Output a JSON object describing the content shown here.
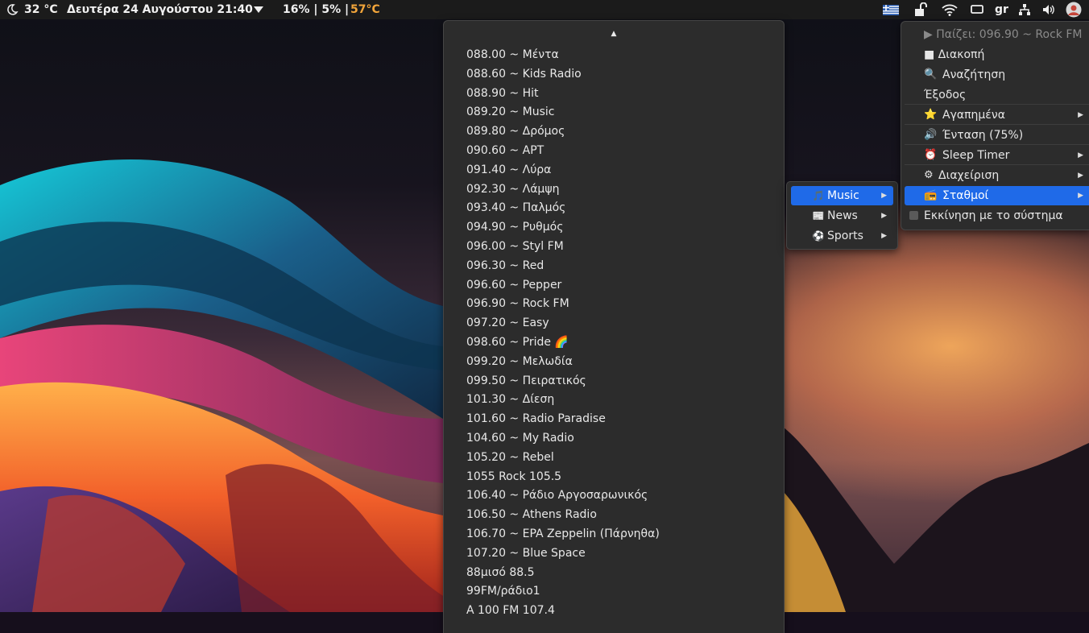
{
  "topbar": {
    "weather": "32 °C",
    "datetime": "Δευτέρα 24 Αυγούστου 21:40",
    "cpu": "16% | 5% |",
    "cpu_temp": "57°C",
    "keyboard_layout": "gr",
    "colors": {
      "bar_bg": "#1b1b1b",
      "hot": "#f2a53a"
    }
  },
  "stations_menu": {
    "scroll_indicator": "▲",
    "items": [
      "088.00 ~ Μέντα",
      "088.60 ~ Kids Radio",
      "088.90 ~ Hit",
      "089.20 ~ Music",
      "089.80 ~ Δρόμος",
      "090.60 ~ ΑΡΤ",
      "091.40 ~ Λύρα",
      "092.30 ~ Λάμψη",
      "093.40 ~ Παλμός",
      "094.90 ~ Ρυθμός",
      "096.00 ~ Styl FM",
      "096.30 ~ Red",
      "096.60 ~ Pepper",
      "096.90 ~ Rock FM",
      "097.20 ~ Easy",
      "098.60 ~ Pride 🌈",
      "099.20 ~ Μελωδία",
      "099.50 ~ Πειρατικός",
      "101.30 ~ Δίεση",
      "101.60 ~ Radio Paradise",
      "104.60 ~ My Radio",
      "105.20 ~ Rebel",
      "1055 Rock 105.5",
      "106.40 ~ Ράδιο Αργοσαρωνικός",
      "106.50 ~ Athens Radio",
      "106.70 ~ EPA Zeppelin (Πάρνηθα)",
      "107.20 ~ Blue Space",
      "88μισό 88.5",
      "99FM/ράδιο1",
      "A 100 FM 107.4"
    ]
  },
  "categories_menu": {
    "items": [
      {
        "icon": "🎵",
        "label": "Music",
        "active": true
      },
      {
        "icon": "📰",
        "label": "News",
        "active": false
      },
      {
        "icon": "⚽",
        "label": "Sports",
        "active": false
      }
    ],
    "submenu_arrow": "▶"
  },
  "main_menu": {
    "now_playing": "▶ Παίζει: 096.90 ~ Rock FM",
    "stop": "■ Διακοπή",
    "search": {
      "icon": "🔍",
      "label": "Αναζήτηση"
    },
    "exit": "Έξοδος",
    "favorites": {
      "icon": "⭐",
      "label": "Αγαπημένα"
    },
    "volume": {
      "icon": "🔊",
      "label": "Ένταση (75%)"
    },
    "sleep_timer": {
      "icon": "⏰",
      "label": "Sleep Timer"
    },
    "manage": {
      "icon": "⚙",
      "label": "Διαχείριση"
    },
    "stations": {
      "icon": "📻",
      "label": "Σταθμοί"
    },
    "autostart": "Εκκίνηση με το σύστημα",
    "accent": "#1f6ae8"
  }
}
